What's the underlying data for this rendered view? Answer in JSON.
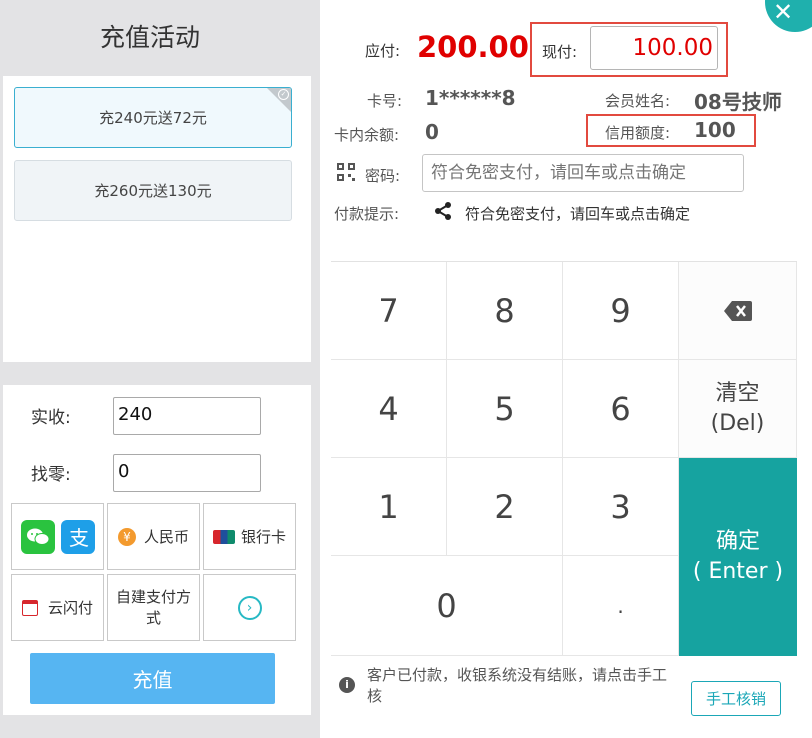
{
  "left": {
    "title": "充值活动",
    "promos": [
      {
        "label": "充240元送72元",
        "selected": true
      },
      {
        "label": "充260元送130元",
        "selected": false
      }
    ],
    "received_label": "实收:",
    "received_value": "240",
    "change_label": "找零:",
    "change_value": "0",
    "pay_methods": {
      "cash": "人民币",
      "bank_card": "银行卡",
      "cloud_pay": "云闪付",
      "custom": "自建支付方式"
    },
    "topup_label": "充值"
  },
  "right": {
    "due_label": "应付:",
    "due_value": "200.00",
    "actual_label": "现付:",
    "actual_value": "100.00",
    "card_label": "卡号:",
    "card_value": "1******8",
    "member_label": "会员姓名:",
    "member_value": "08号技师",
    "balance_label": "卡内余额:",
    "balance_value": "0",
    "credit_label": "信用额度:",
    "credit_value": "100",
    "password_label": "密码:",
    "password_placeholder": "符合免密支付，请回车或点击确定",
    "hint_label": "付款提示:",
    "hint_value": "符合免密支付，请回车或点击确定",
    "keys": {
      "k7": "7",
      "k8": "8",
      "k9": "9",
      "k4": "4",
      "k5": "5",
      "k6": "6",
      "k1": "1",
      "k2": "2",
      "k3": "3",
      "k0": "0",
      "dot": ".",
      "clear": "清空",
      "clear_sub": "(Del)",
      "enter": "确定",
      "enter_sub": "( Enter )"
    },
    "notice": "客户已付款，收银系统没有结账，请点击手工核",
    "manual_label": "手工核销"
  },
  "colors": {
    "accent": "#16a3a0",
    "due_red": "#e00000",
    "highlight_box": "#e24a3f",
    "topup_blue": "#56b5f2"
  }
}
